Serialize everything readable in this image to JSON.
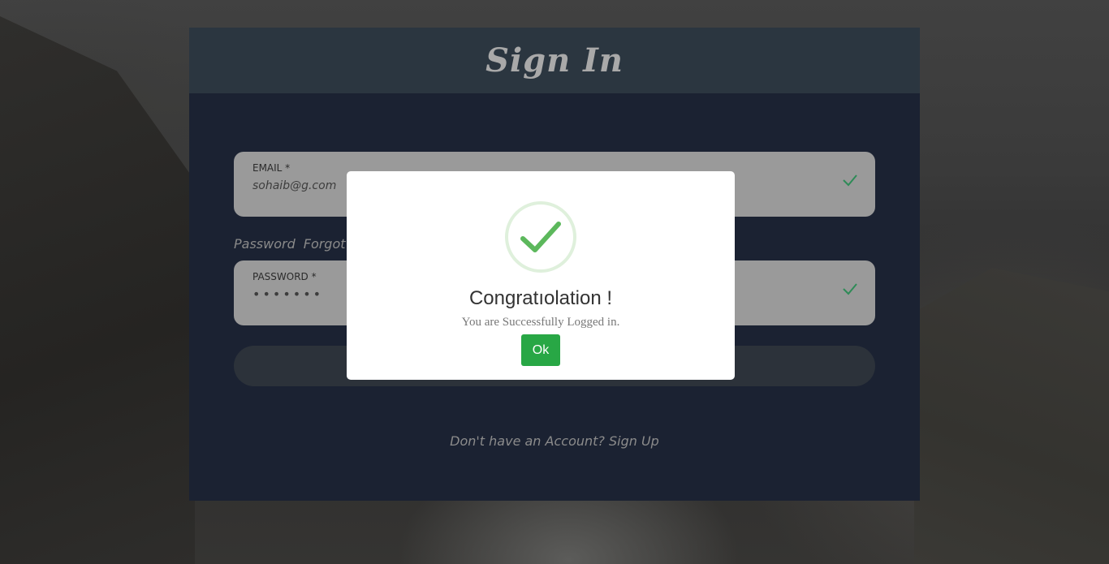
{
  "signin": {
    "title": "Sign In",
    "email": {
      "label": "EMAIL *",
      "value": "sohaib@g.com"
    },
    "password_row": {
      "label": "Password",
      "forgot": "Forgot?"
    },
    "password": {
      "label": "PASSWORD *",
      "value": "•••••••"
    },
    "signup_prompt": "Don't have an Account? Sign Up"
  },
  "modal": {
    "icon": "check-circle-icon",
    "title": "Congratıolation !",
    "message": "You are Successfully Logged in.",
    "ok_label": "Ok"
  },
  "colors": {
    "card_bg": "#1b2232",
    "header_bg": "#2b3640",
    "field_bg": "#9a9a9a",
    "check_green": "#2e8b57",
    "success_green": "#5cb85c",
    "ok_button": "#28a745"
  }
}
